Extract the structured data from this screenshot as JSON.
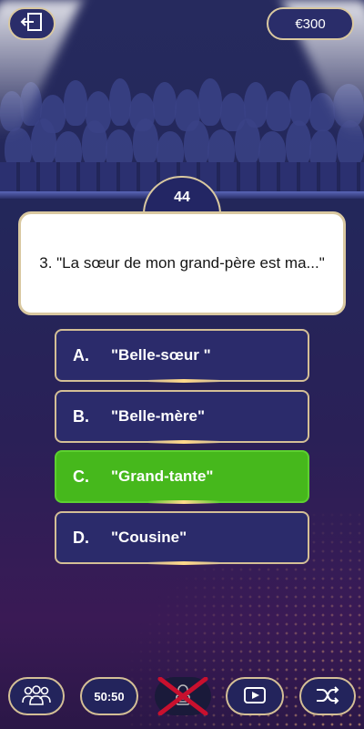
{
  "header": {
    "exit_icon": "exit-door-icon",
    "money": "€300"
  },
  "timer": {
    "value": "44"
  },
  "question": {
    "text": "3. \"La sœur de mon grand-père est ma...\""
  },
  "answers": [
    {
      "letter": "A.",
      "text": "\"Belle-sœur \"",
      "state": "default"
    },
    {
      "letter": "B.",
      "text": "\"Belle-mère\"",
      "state": "default"
    },
    {
      "letter": "C.",
      "text": "\"Grand-tante\"",
      "state": "correct"
    },
    {
      "letter": "D.",
      "text": "\"Cousine\"",
      "state": "default"
    }
  ],
  "lifelines": {
    "audience_icon": "audience-icon",
    "fifty_fifty": "50:50",
    "phone_icon": "phone-a-friend-icon",
    "phone_used": true,
    "video_icon": "video-play-icon",
    "shuffle_icon": "shuffle-icon"
  },
  "colors": {
    "correct": "#46b81c",
    "border_gold": "#d9c8a0",
    "answer_bg": "#2b2b6b",
    "used_cross": "#c8102e"
  }
}
